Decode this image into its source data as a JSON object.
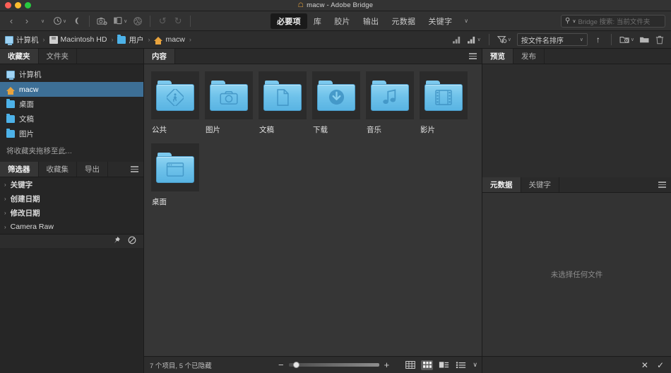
{
  "titlebar": {
    "title": "macw - Adobe Bridge",
    "home_icon": "home-icon",
    "traffic": [
      "close-button",
      "minimize-button",
      "maximize-button"
    ]
  },
  "toolbar": {
    "nav": [
      {
        "name": "back-button",
        "glyph": "‹"
      },
      {
        "name": "forward-button",
        "glyph": "›"
      },
      {
        "name": "nav-dropdown",
        "glyph": "∨"
      }
    ],
    "recent": {
      "name": "recent-folders-button",
      "glyph": "◔",
      "caret": "∨"
    },
    "boomerang": {
      "name": "boomerang-button",
      "glyph": "☾"
    },
    "camera": {
      "name": "get-photos-from-camera-button"
    },
    "refine": {
      "name": "refine-button",
      "caret": "∨"
    },
    "open_recent": {
      "name": "open-in-camera-raw-button"
    },
    "rotate_ccw": {
      "name": "rotate-counterclockwise-button",
      "glyph": "↺"
    },
    "rotate_cw": {
      "name": "rotate-clockwise-button",
      "glyph": "↻"
    },
    "workspace_tabs": [
      {
        "label": "必要项",
        "active": true
      },
      {
        "label": "库",
        "active": false
      },
      {
        "label": "胶片",
        "active": false
      },
      {
        "label": "输出",
        "active": false
      },
      {
        "label": "元数据",
        "active": false
      },
      {
        "label": "关键字",
        "active": false
      }
    ],
    "workspace_more": "∨",
    "search": {
      "icon": "search-icon",
      "caret": "∨",
      "placeholder": "Bridge 搜索: 当前文件夹"
    }
  },
  "pathbar": {
    "crumbs": [
      {
        "label": "计算机",
        "icon": "computer-icon"
      },
      {
        "label": "Macintosh HD",
        "icon": "disk-icon"
      },
      {
        "label": "用户",
        "icon": "folder-icon"
      },
      {
        "label": "macw",
        "icon": "home-icon"
      }
    ],
    "separator": "›",
    "trailing_separator": "›",
    "right_tools": [
      {
        "name": "filter-rating-button",
        "glyph": "◢"
      },
      {
        "name": "filter-rating-dropdown",
        "glyph": "◢",
        "caret": "∨"
      },
      {
        "name": "filter-items-button",
        "glyph": "∇",
        "caret": "∨"
      }
    ],
    "sort": {
      "label": "按文件名排序",
      "caret": "∨"
    },
    "sort_direction": {
      "name": "sort-ascending-button",
      "glyph": "↑"
    },
    "make_new": {
      "name": "new-folder-with-options-button",
      "caret": "∨"
    },
    "new_folder": {
      "name": "new-folder-button"
    },
    "delete": {
      "name": "delete-button",
      "glyph": "Ὕ1"
    }
  },
  "favorites_panel": {
    "tabs": [
      {
        "label": "收藏夹",
        "active": true
      },
      {
        "label": "文件夹",
        "active": false
      }
    ],
    "items": [
      {
        "label": "计算机",
        "icon": "computer-icon",
        "selected": false
      },
      {
        "label": "macw",
        "icon": "home-icon",
        "selected": true
      },
      {
        "label": "桌面",
        "icon": "folder-icon",
        "selected": false
      },
      {
        "label": "文稿",
        "icon": "folder-icon",
        "selected": false
      },
      {
        "label": "图片",
        "icon": "folder-icon",
        "selected": false
      }
    ],
    "hint": "将收藏夹拖移至此..."
  },
  "filter_panel": {
    "tabs": [
      {
        "label": "筛选器",
        "active": true
      },
      {
        "label": "收藏集",
        "active": false
      },
      {
        "label": "导出",
        "active": false
      }
    ],
    "rows": [
      {
        "label": "关键字",
        "bold": true
      },
      {
        "label": "创建日期",
        "bold": true
      },
      {
        "label": "修改日期",
        "bold": true
      },
      {
        "label": "Camera Raw",
        "bold": false
      }
    ],
    "triangle": "›",
    "bottom_tools": [
      {
        "name": "keep-filter-pin-icon",
        "glyph": "📌"
      },
      {
        "name": "clear-filter-icon",
        "glyph": "⊘"
      }
    ]
  },
  "content_panel": {
    "tabs": [
      {
        "label": "内容",
        "active": true
      }
    ],
    "items": [
      {
        "label": "公共",
        "icon": "public-folder-icon"
      },
      {
        "label": "图片",
        "icon": "pictures-folder-icon"
      },
      {
        "label": "文稿",
        "icon": "documents-folder-icon"
      },
      {
        "label": "下载",
        "icon": "downloads-folder-icon"
      },
      {
        "label": "音乐",
        "icon": "music-folder-icon"
      },
      {
        "label": "影片",
        "icon": "movies-folder-icon"
      },
      {
        "label": "桌面",
        "icon": "desktop-folder-icon"
      }
    ]
  },
  "statusbar": {
    "count_text": "7 个项目, 5 个已隐藏",
    "zoom_out": "−",
    "zoom_in": "+",
    "view_buttons": [
      {
        "name": "grid-view-button",
        "active": false
      },
      {
        "name": "thumbnail-view-button",
        "active": true
      },
      {
        "name": "details-view-button",
        "active": false
      },
      {
        "name": "list-view-button",
        "active": false
      }
    ],
    "view_more": "∨"
  },
  "preview_panel": {
    "tabs": [
      {
        "label": "预览",
        "active": true
      },
      {
        "label": "发布",
        "active": false
      }
    ]
  },
  "metadata_panel": {
    "tabs": [
      {
        "label": "元数据",
        "active": true
      },
      {
        "label": "关键字",
        "active": false
      }
    ],
    "empty_text": "未选择任何文件",
    "bottom_tools": [
      {
        "name": "cancel-metadata-icon",
        "glyph": "✕"
      },
      {
        "name": "apply-metadata-icon",
        "glyph": "✓"
      }
    ]
  },
  "colors": {
    "selection_blue": "#3d6f96",
    "folder_blue": "#6fc2ea",
    "panel_bg": "#2d2d2d",
    "content_bg": "#363636"
  }
}
